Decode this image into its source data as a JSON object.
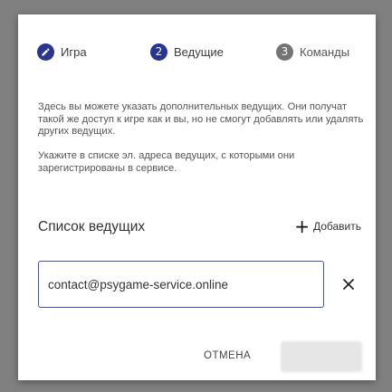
{
  "stepper": {
    "steps": [
      {
        "label": "Игра",
        "marker": "pencil-icon",
        "state": "completed"
      },
      {
        "label": "Ведущие",
        "marker": "2",
        "state": "active"
      },
      {
        "label": "Команды",
        "marker": "3",
        "state": "inactive"
      }
    ]
  },
  "description": {
    "paragraph1": "Здесь вы можете указать дополнительных ведущих. Они получат такой же доступ к игре как и вы, но не смогут добавлять или удалять других ведущих.",
    "paragraph2": "Укажите в списке эл. адреса ведущих, с которыми они зарегистрированы в сервисе."
  },
  "hosts": {
    "title": "Список ведущих",
    "add_label": "Добавить",
    "inputs": [
      {
        "value": "contact@psygame-service.online"
      }
    ]
  },
  "actions": {
    "cancel_label": "ОТМЕНА",
    "next_label": ""
  },
  "colors": {
    "accent": "#283593",
    "inactive_step": "#757575",
    "input_border": "#3f51b5"
  }
}
